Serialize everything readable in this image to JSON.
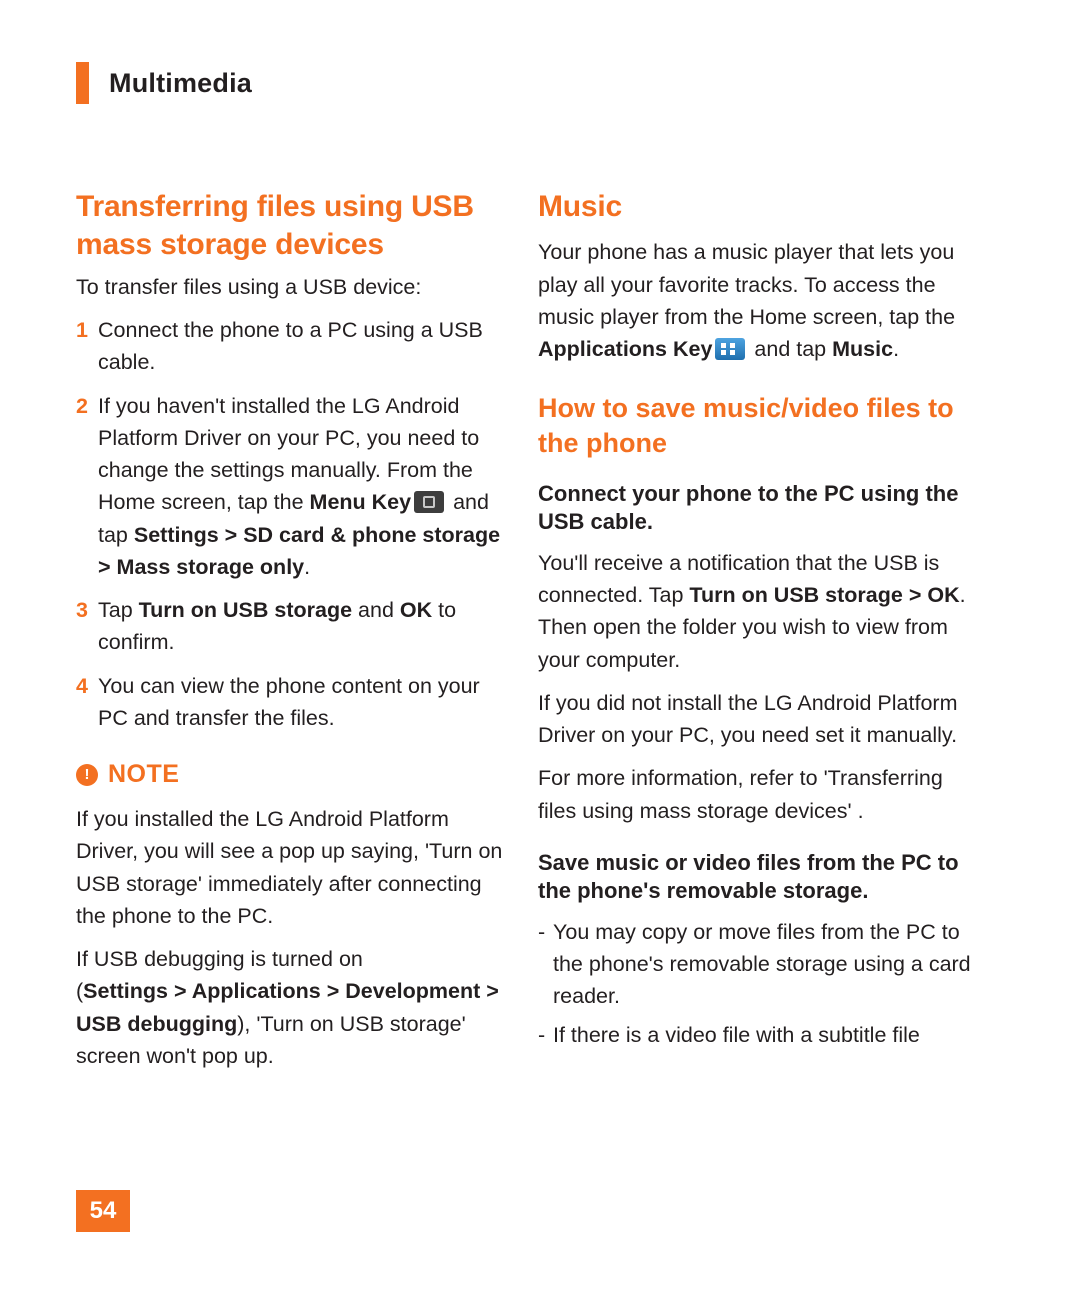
{
  "header": {
    "chapter": "Multimedia"
  },
  "colors": {
    "accent": "#F37021",
    "text": "#231F20"
  },
  "left": {
    "heading": "Transferring files using USB mass storage devices",
    "intro": "To transfer files using a USB device:",
    "steps": [
      {
        "num": "1",
        "parts": [
          {
            "t": "Connect the phone to a PC using a USB cable.",
            "b": false
          }
        ]
      },
      {
        "num": "2",
        "parts": [
          {
            "t": "If you haven't installed the LG Android Platform Driver on your PC, you need to change the settings manually. From the Home screen, tap the ",
            "b": false
          },
          {
            "t": "Menu Key",
            "b": true
          },
          {
            "icon": "menu-key-icon"
          },
          {
            "t": " and tap ",
            "b": false
          },
          {
            "t": "Settings",
            "b": true
          },
          {
            "t": " > ",
            "b": true
          },
          {
            "t": "SD card & phone storage",
            "b": true
          },
          {
            "t": " > ",
            "b": true
          },
          {
            "t": "Mass storage only",
            "b": true
          },
          {
            "t": ".",
            "b": false
          }
        ]
      },
      {
        "num": "3",
        "parts": [
          {
            "t": "Tap ",
            "b": false
          },
          {
            "t": "Turn on USB storage",
            "b": true
          },
          {
            "t": " and ",
            "b": false
          },
          {
            "t": "OK",
            "b": true
          },
          {
            "t": " to confirm.",
            "b": false
          }
        ]
      },
      {
        "num": "4",
        "parts": [
          {
            "t": "You can view the phone content on your PC and transfer the files.",
            "b": false
          }
        ]
      }
    ],
    "note_icon": "!",
    "note_label": "NOTE",
    "note_paragraph_1": "If you installed the LG Android Platform Driver, you will see a pop up saying, 'Turn on USB storage' immediately after connecting the phone to the PC.",
    "note_paragraph_2_lead": "If USB debugging is turned on",
    "note_paragraph_2_parts": [
      {
        "t": "(",
        "b": false
      },
      {
        "t": "Settings",
        "b": true
      },
      {
        "t": " > ",
        "b": true
      },
      {
        "t": "Applications",
        "b": true
      },
      {
        "t": " > ",
        "b": true
      },
      {
        "t": "Development",
        "b": true
      },
      {
        "t": " > ",
        "b": true
      },
      {
        "t": "USB debugging",
        "b": true
      },
      {
        "t": "), 'Turn on USB storage' screen won't pop up.",
        "b": false
      }
    ]
  },
  "right": {
    "music_heading": "Music",
    "music_paragraph_parts": [
      {
        "t": "Your phone has a music player that lets you play all your favorite tracks. To access the music player from the Home screen, tap the ",
        "b": false
      },
      {
        "t": "Applications Key",
        "b": true
      },
      {
        "icon": "applications-key-icon"
      },
      {
        "t": " and tap ",
        "b": false
      },
      {
        "t": "Music",
        "b": true
      },
      {
        "t": ".",
        "b": false
      }
    ],
    "save_heading": "How to save music/video files to the phone",
    "connect_subhead": "Connect your phone to the PC using the USB cable.",
    "connect_paragraph_parts": [
      {
        "t": "You'll receive a notification that the USB is connected. Tap ",
        "b": false
      },
      {
        "t": "Turn on USB storage",
        "b": true
      },
      {
        "t": " > ",
        "b": true
      },
      {
        "t": "OK",
        "b": true
      },
      {
        "t": ". Then open the folder you wish to view from your computer.",
        "b": false
      }
    ],
    "driver_paragraph": "If you did not install the LG Android Platform Driver on your PC, you need set it manually.",
    "more_info_paragraph": "For more information, refer to 'Transferring files using mass storage devices' .",
    "save_files_subhead": "Save music or video files from the PC to the phone's removable storage.",
    "bullets": [
      "You may copy or move files from the PC to the phone's removable storage using a card reader.",
      "If there is a video file with a subtitle file"
    ],
    "bullet_marker": "-"
  },
  "footer": {
    "page_number": "54"
  }
}
